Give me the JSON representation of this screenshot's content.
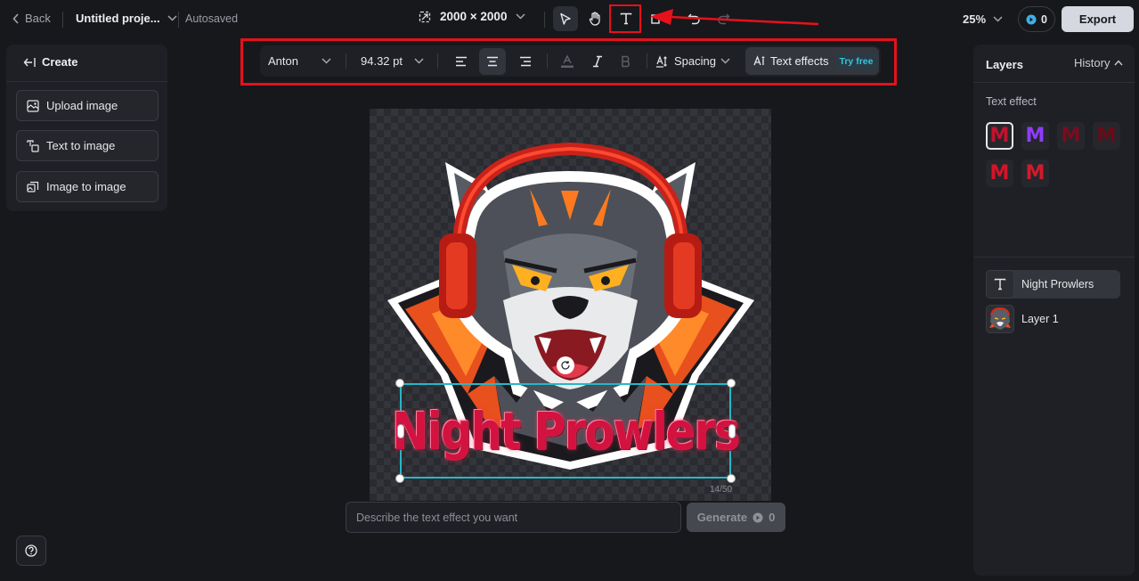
{
  "topbar": {
    "back_label": "Back",
    "project_name": "Untitled proje...",
    "autosave_status": "Autosaved",
    "canvas_size": "2000 × 2000",
    "zoom": "25%",
    "credits": "0",
    "export_label": "Export"
  },
  "text_toolbar": {
    "font": "Anton",
    "font_size": "94.32 pt",
    "spacing_label": "Spacing",
    "effects_label": "Text effects",
    "try_free": "Try free"
  },
  "left_panel": {
    "title": "Create",
    "buttons": [
      {
        "label": "Upload image"
      },
      {
        "label": "Text to image"
      },
      {
        "label": "Image to image"
      }
    ]
  },
  "canvas": {
    "text_layer": "Night Prowlers",
    "char_count": "14/50"
  },
  "prompt": {
    "placeholder": "Describe the text effect you want",
    "generate_label": "Generate",
    "generate_cost": "0"
  },
  "right_panel": {
    "tab_layers": "Layers",
    "tab_history": "History",
    "text_effect_label": "Text effect",
    "swatch_letter": "M",
    "swatch_colors": [
      "#c3122e",
      "#8f3cff",
      "#7a0c1f",
      "#6d0a18",
      "#d51428",
      "#d31a2b"
    ],
    "layers": [
      {
        "name": "Night Prowlers",
        "icon": "text-icon"
      },
      {
        "name": "Layer 1",
        "icon": "wolf-thumbnail"
      }
    ]
  },
  "colors": {
    "accent_selection": "#28b7c8",
    "highlight_red": "#e5111b",
    "text_effect_red": "#d3123f"
  }
}
